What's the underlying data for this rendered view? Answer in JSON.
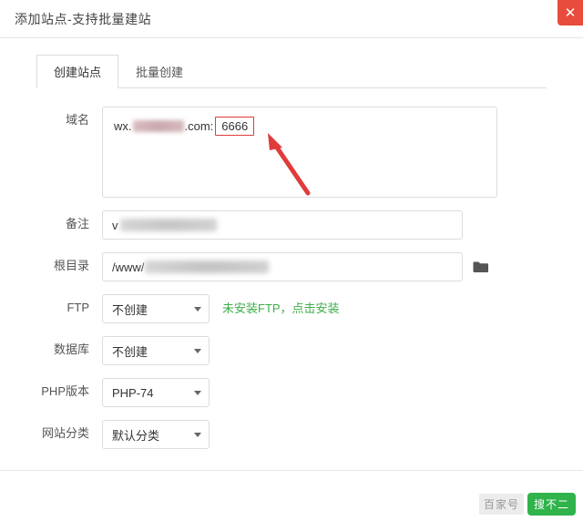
{
  "window": {
    "title": "添加站点-支持批量建站",
    "close_label": "✕"
  },
  "tabs": [
    {
      "label": "创建站点",
      "active": true
    },
    {
      "label": "批量创建",
      "active": false
    }
  ],
  "form": {
    "domain": {
      "label": "域名",
      "prefix": "wx.",
      "suffix": ".com:",
      "port": "6666"
    },
    "note": {
      "label": "备注",
      "value": "v"
    },
    "root": {
      "label": "根目录",
      "value": "/www/",
      "browse_icon": "folder-icon"
    },
    "ftp": {
      "label": "FTP",
      "value": "不创建",
      "hint": "未安装FTP，点击安装"
    },
    "database": {
      "label": "数据库",
      "value": "不创建"
    },
    "php": {
      "label": "PHP版本",
      "value": "PHP-74"
    },
    "category": {
      "label": "网站分类",
      "value": "默认分类"
    }
  },
  "watermark": {
    "left": "百家号",
    "right": "搜不二"
  },
  "colors": {
    "accent_green": "#3fae4a",
    "highlight_red": "#e03b3b",
    "close_red": "#e74c3c"
  }
}
